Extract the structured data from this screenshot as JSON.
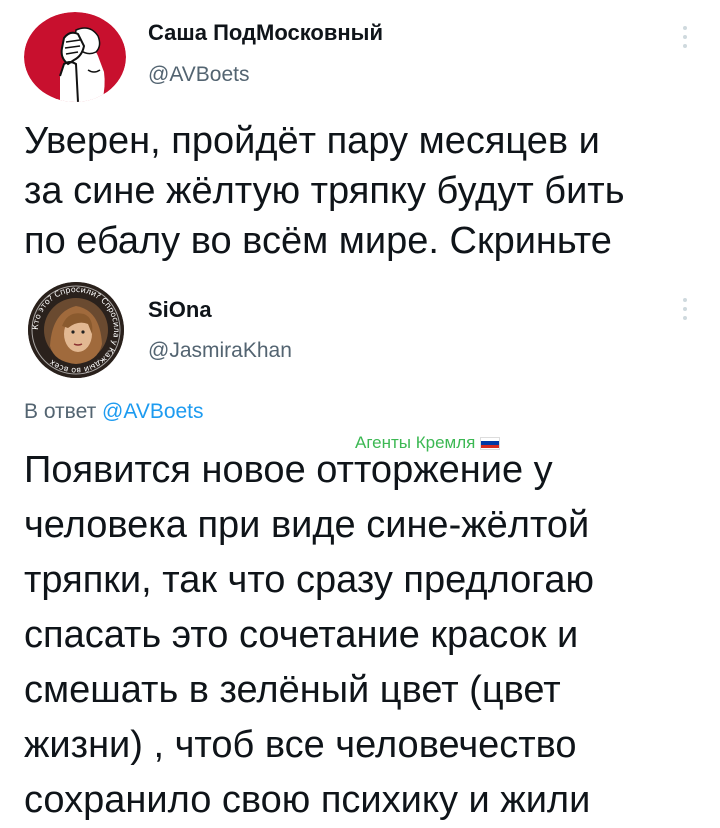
{
  "tweets": [
    {
      "display_name": "Саша ПодМосковный",
      "handle": "@AVBoets",
      "text": "Уверен, пройдёт пару месяцев и\nза сине жёлтую тряпку будут бить\nпо ебалу во всём мире. Скриньте"
    },
    {
      "display_name": "SiOna",
      "handle": "@JasmiraKhan",
      "avatar_ring_text": "Кто это? Спросили? Спросила у Каждый во всех",
      "reply_prefix": "В ответ",
      "reply_to": "@AVBoets",
      "text": "Появится новое отторжение у\nчеловека при виде сине-жёлтой\nтряпки, так что сразу предлогаю\nспасать это сочетание красок и\nсмешать в зелёный цвет (цвет\nжизни) , чтоб все человечество\nсохранило свою психику и жили"
    }
  ],
  "watermark": {
    "text": "Агенты Кремля",
    "icon": "russian-flag-icon",
    "color": "#3cb853"
  },
  "colors": {
    "text_primary": "#0f1419",
    "text_secondary": "#536471",
    "link": "#1d9bf0",
    "more_dots": "#cfd9de",
    "avatar1_bg": "#c8102e"
  }
}
